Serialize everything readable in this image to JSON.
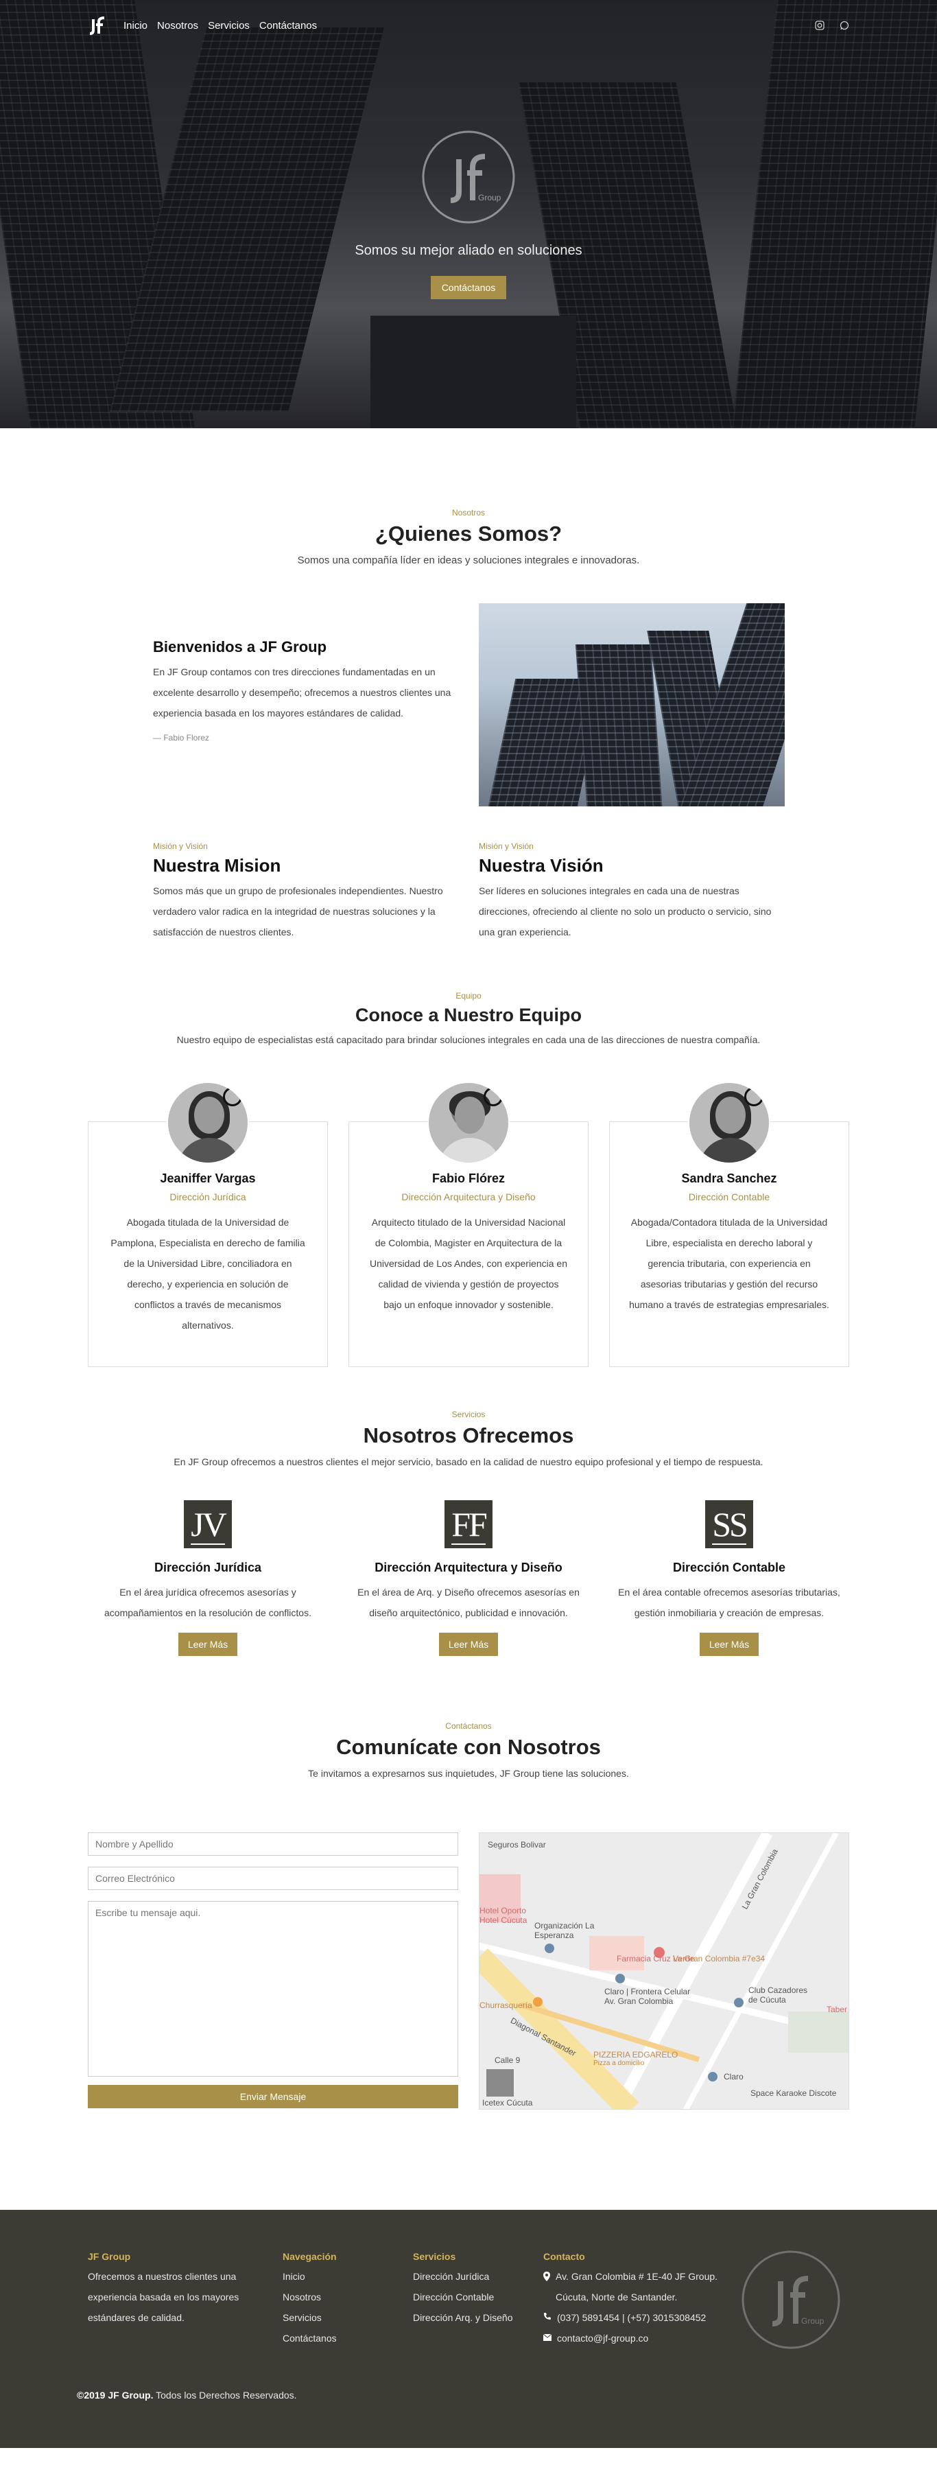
{
  "nav": {
    "links": [
      "Inicio",
      "Nosotros",
      "Servicios",
      "Contáctanos"
    ]
  },
  "hero": {
    "tagline": "Somos su mejor aliado en soluciones",
    "cta": "Contáctanos"
  },
  "about": {
    "kicker": "Nosotros",
    "title": "¿Quienes Somos?",
    "subtitle": "Somos una compañía líder en ideas y soluciones integrales e innovadoras.",
    "welcome_title": "Bienvenidos a JF Group",
    "welcome_text": "En JF Group contamos con tres direcciones fundamentadas en un excelente desarrollo y desempeño; ofrecemos a nuestros clientes una experiencia basada en los mayores estándares de calidad.",
    "signature": "— Fabio Florez",
    "mission_kicker": "Misión y Visión",
    "mission_title": "Nuestra Mision",
    "mission_text": "Somos más que un grupo de profesionales independientes. Nuestro verdadero valor radica en la integridad de nuestras soluciones y la satisfacción de nuestros clientes.",
    "vision_kicker": "Misión y Visión",
    "vision_title": "Nuestra Visión",
    "vision_text": "Ser líderes en soluciones integrales en cada una de nuestras direcciones, ofreciendo al cliente no solo un producto o servicio, sino una gran experiencia."
  },
  "team": {
    "kicker": "Equipo",
    "title": "Conoce a Nuestro Equipo",
    "subtitle": "Nuestro equipo de especialistas está capacitado para brindar soluciones integrales en cada una de las direcciones de nuestra compañía.",
    "members": [
      {
        "name": "Jeaniffer Vargas",
        "role": "Dirección Jurídica",
        "bio": "Abogada titulada de la Universidad de Pamplona, Especialista en derecho de familia de la Universidad Libre, conciliadora en derecho, y experiencia en solución de conflictos a través de mecanismos alternativos."
      },
      {
        "name": "Fabio Flórez",
        "role": "Dirección Arquitectura y Diseño",
        "bio": "Arquitecto titulado de la Universidad Nacional de Colombia, Magister en Arquitectura de la Universidad de Los Andes, con experiencia en calidad de vivienda y gestión de proyectos bajo un enfoque innovador y sostenible."
      },
      {
        "name": "Sandra Sanchez",
        "role": "Dirección Contable",
        "bio": "Abogada/Contadora titulada de la Universidad Libre, especialista en derecho laboral y gerencia tributaria, con experiencia en asesorias tributarias y gestión del recurso humano a través de estrategias empresariales."
      }
    ]
  },
  "services": {
    "kicker": "Servicios",
    "title": "Nosotros Ofrecemos",
    "subtitle": "En JF Group ofrecemos a nuestros clientes el mejor servicio, basado en la calidad de nuestro equipo profesional y el tiempo de respuesta.",
    "items": [
      {
        "monogram": "JV",
        "title": "Dirección Jurídica",
        "text": "En el área jurídica ofrecemos asesorías y acompañamientos en la resolución de conflictos.",
        "button": "Leer Más"
      },
      {
        "monogram": "FF",
        "title": "Dirección Arquitectura y Diseño",
        "text": "En el área de Arq. y Diseño ofrecemos asesorías en diseño arquitectónico, publicidad e innovación.",
        "button": "Leer Más"
      },
      {
        "monogram": "SS",
        "title": "Dirección Contable",
        "text": "En el área contable ofrecemos asesorías tributarias, gestión inmobiliaria y creación de empresas.",
        "button": "Leer Más"
      }
    ]
  },
  "contact": {
    "kicker": "Contáctanos",
    "title": "Comunícate con Nosotros",
    "subtitle": "Te invitamos a expresarnos sus inquietudes, JF Group tiene las soluciones.",
    "name_placeholder": "Nombre y Apellido",
    "email_placeholder": "Correo Electrónico",
    "message_placeholder": "Escribe tu mensaje aqui.",
    "send": "Enviar Mensaje",
    "map_labels": [
      "Seguros Bolivar",
      "Hotel Oporto",
      "Hotel Cúcuta",
      "Organización La Esperanza",
      "Farmacia Cruz Verde",
      "La Gran Colombia #7e34",
      "Claro | Frontera Celular Av. Gran Colombia",
      "Club Cazadores de Cúcuta",
      "Churrasquería",
      "Diagonal Santander",
      "PIZZERIA EDGARELO",
      "Pizza a domicilio",
      "Calle 9",
      "Claro",
      "Icetex Cúcuta",
      "Space Karaoke Discote",
      "La Gran Colombia",
      "Taber"
    ]
  },
  "footer": {
    "brand_title": "JF Group",
    "brand_text": "Ofrecemos a nuestros clientes una experiencia basada en los mayores estándares de calidad.",
    "nav_title": "Navegación",
    "nav_links": [
      "Inicio",
      "Nosotros",
      "Servicios",
      "Contáctanos"
    ],
    "services_title": "Servicios",
    "services_links": [
      "Dirección Jurídica",
      "Dirección Contable",
      "Dirección Arq. y Diseño"
    ],
    "contact_title": "Contacto",
    "address": "Av. Gran Colombia # 1E-40 JF Group. Cúcuta, Norte de Santander.",
    "phone": "(037) 5891454 | (+57) 3015308452",
    "email": "contacto@jf-group.co",
    "copyright_brand": "©2019 JF Group.",
    "copyright_text": "Todos los Derechos Reservados."
  },
  "colors": {
    "accent": "#a89048",
    "footer_bg": "#3c3b34",
    "monogram_bg": "#3b3a33"
  }
}
